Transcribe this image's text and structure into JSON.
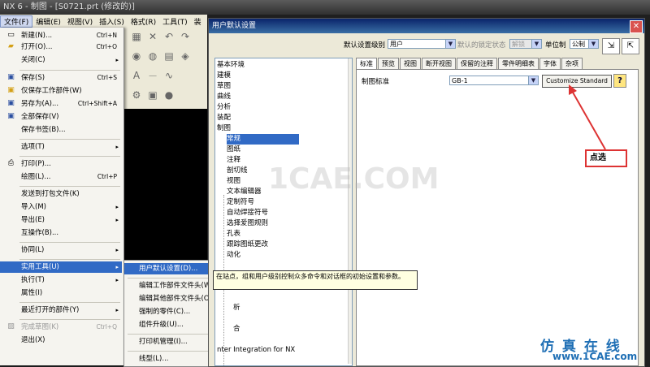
{
  "app": {
    "title": "NX 6 - 制图 - [S0721.prt (修改的)]",
    "menubar": [
      "文件(F)",
      "编辑(E)",
      "视图(V)",
      "插入(S)",
      "格式(R)",
      "工具(T)",
      "装"
    ]
  },
  "file_menu": {
    "items": [
      {
        "label": "新建(N)...",
        "shortcut": "Ctrl+N",
        "icon": "new-file-icon"
      },
      {
        "label": "打开(O)...",
        "shortcut": "Ctrl+O",
        "icon": "open-folder-icon"
      },
      {
        "label": "关闭(C)",
        "arrow": "▸"
      },
      {
        "label": "保存(S)",
        "shortcut": "Ctrl+S",
        "icon": "save-icon"
      },
      {
        "label": "仅保存工作部件(W)",
        "icon": "save-work-part-icon"
      },
      {
        "label": "另存为(A)...",
        "shortcut": "Ctrl+Shift+A",
        "icon": "save-as-icon"
      },
      {
        "label": "全部保存(V)",
        "icon": "save-all-icon"
      },
      {
        "label": "保存书签(B)..."
      },
      {
        "label": "选项(T)",
        "arrow": "▸"
      },
      {
        "label": "打印(P)...",
        "icon": "print-icon"
      },
      {
        "label": "绘图(L)...",
        "shortcut": "Ctrl+P"
      },
      {
        "label": "发送到打包文件(K)"
      },
      {
        "label": "导入(M)",
        "arrow": "▸"
      },
      {
        "label": "导出(E)",
        "arrow": "▸"
      },
      {
        "label": "互操作(B)..."
      },
      {
        "label": "协同(L)",
        "arrow": "▸"
      },
      {
        "label": "实用工具(U)",
        "arrow": "▸"
      },
      {
        "label": "执行(T)",
        "arrow": "▸"
      },
      {
        "label": "属性(I)"
      },
      {
        "label": "最近打开的部件(Y)",
        "arrow": "▸"
      },
      {
        "label": "完成草图(K)",
        "shortcut": "Ctrl+Q"
      },
      {
        "label": "退出(X)"
      }
    ]
  },
  "submenu": {
    "items": [
      "用户默认设置(D)...",
      "编辑工作部件文件头(W)...",
      "编辑其他部件文件头(O)...",
      "强制的零件(C)...",
      "组件升级(U)...",
      "打印机管理(I)...",
      "线型(L)..."
    ]
  },
  "dialog": {
    "title": "用户默认设置",
    "close": "✕",
    "level_label": "默认设置级别",
    "level_value": "用户",
    "lock_label": "默认的锁定状态",
    "lock_value": "解锁",
    "unit_label": "单位制",
    "unit_value": "公制",
    "tree": [
      {
        "label": "基本环境",
        "level": 0
      },
      {
        "label": "建模",
        "level": 0
      },
      {
        "label": "草图",
        "level": 0
      },
      {
        "label": "曲线",
        "level": 0
      },
      {
        "label": "分析",
        "level": 0
      },
      {
        "label": "装配",
        "level": 0
      },
      {
        "label": "制图",
        "level": 0
      },
      {
        "label": "常规",
        "level": 1,
        "selected": true
      },
      {
        "label": "图纸",
        "level": 1
      },
      {
        "label": "注释",
        "level": 1
      },
      {
        "label": "剖切线",
        "level": 1
      },
      {
        "label": "视图",
        "level": 1
      },
      {
        "label": "文本编辑器",
        "level": 1
      },
      {
        "label": "定制符号",
        "level": 1
      },
      {
        "label": "自动焊接符号",
        "level": 1
      },
      {
        "label": "选择爱图规则",
        "level": 1
      },
      {
        "label": "孔表",
        "level": 1
      },
      {
        "label": "跟踪图纸更改",
        "level": 1
      },
      {
        "label": "动化",
        "level": 1
      },
      {
        "label": "析",
        "level": 0
      },
      {
        "label": "合",
        "level": 0
      },
      {
        "label": "nter Integration for NX",
        "level": 0
      }
    ],
    "tabs": [
      "标准",
      "预览",
      "视图",
      "断开视图",
      "保留的注释",
      "零件明细表",
      "字体",
      "杂项"
    ],
    "active_tab": 0,
    "drafting_standard_label": "制图标准",
    "drafting_standard_value": "GB-1",
    "customize_button": "Customize Standard",
    "help_button": "?",
    "tooltip": "在站点，组和用户级别控制众多命令和对话框的初始设置和参数。"
  },
  "annotation": {
    "callout": "点选"
  },
  "watermarks": {
    "center": "1CAE.COM",
    "brand": "仿 真 在 线",
    "url": "www.1CAE.com"
  }
}
